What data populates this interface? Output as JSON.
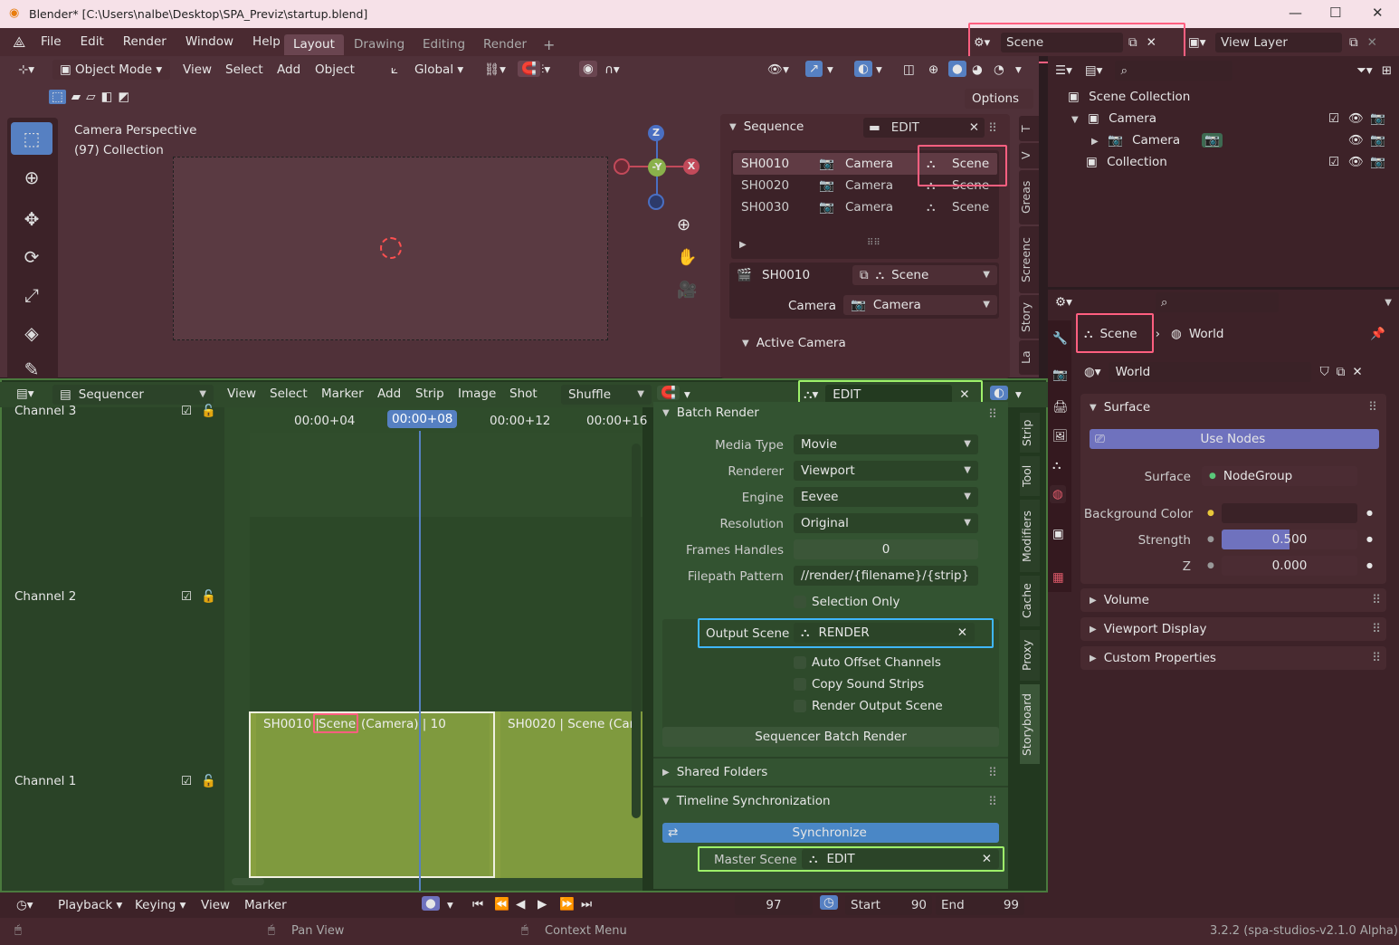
{
  "window": {
    "title": "Blender* [C:\\Users\\nalbe\\Desktop\\SPA_Previz\\startup.blend]"
  },
  "menu": {
    "items": [
      "File",
      "Edit",
      "Render",
      "Window",
      "Help"
    ]
  },
  "workspaces": [
    "Layout",
    "Drawing",
    "Editing",
    "Render"
  ],
  "scene_selector": {
    "value": "Scene"
  },
  "view_layer": {
    "value": "View Layer"
  },
  "viewport": {
    "mode": "Object Mode",
    "menus": [
      "View",
      "Select",
      "Add",
      "Object"
    ],
    "orientation": "Global",
    "options": "Options",
    "overlay_title": "Camera Perspective",
    "overlay_sub": "(97) Collection",
    "gizmo": {
      "z": "Z",
      "y": "-Y",
      "x": "X"
    }
  },
  "sequence_panel": {
    "title": "Sequence",
    "scene": "EDIT",
    "shots": [
      {
        "name": "SH0010",
        "camera": "Camera",
        "scene": "Scene"
      },
      {
        "name": "SH0020",
        "camera": "Camera",
        "scene": "Scene"
      },
      {
        "name": "SH0030",
        "camera": "Camera",
        "scene": "Scene"
      }
    ],
    "active_shot": "SH0010",
    "active_scene": "Scene",
    "camera_label": "Camera",
    "camera_value": "Camera",
    "active_camera": "Active Camera",
    "tabs": [
      "T",
      "V",
      "Greas",
      "Screenc",
      "Story",
      "La"
    ]
  },
  "sequencer": {
    "editor": "Sequencer",
    "menus": [
      "View",
      "Select",
      "Marker",
      "Add",
      "Strip",
      "Image",
      "Shot"
    ],
    "mode": "Shuffle",
    "scene": "EDIT",
    "channels": [
      "Channel 3",
      "Channel 2",
      "Channel 1"
    ],
    "ticks": [
      "00:00+04",
      "00:00+08",
      "00:00+12",
      "00:00+16"
    ],
    "current_tick": "00:00+08",
    "strip1": {
      "shot": "SH0010 |",
      "scene": "Scene",
      "rest": "(Camera) | 10"
    },
    "strip2": "SH0020 | Scene (Cam",
    "tabs": [
      "Strip",
      "Tool",
      "Modifiers",
      "Cache",
      "Proxy",
      "Storyboard"
    ]
  },
  "batch_render": {
    "title": "Batch Render",
    "media_type_label": "Media Type",
    "media_type": "Movie",
    "renderer_label": "Renderer",
    "renderer": "Viewport",
    "engine_label": "Engine",
    "engine": "Eevee",
    "resolution_label": "Resolution",
    "resolution": "Original",
    "frames_handles_label": "Frames Handles",
    "frames_handles": "0",
    "filepath_label": "Filepath Pattern",
    "filepath": "//render/{filename}/{strip}",
    "selection_only": "Selection Only",
    "output_scene_label": "Output Scene",
    "output_scene": "RENDER",
    "auto_offset": "Auto Offset Channels",
    "copy_sound": "Copy Sound Strips",
    "render_output": "Render Output Scene",
    "button": "Sequencer Batch Render"
  },
  "shared_folders": "Shared Folders",
  "timeline_sync": {
    "title": "Timeline Synchronization",
    "button": "Synchronize",
    "master_label": "Master Scene",
    "master_value": "EDIT"
  },
  "outliner": {
    "items": [
      {
        "label": "Scene Collection"
      },
      {
        "label": "Camera"
      },
      {
        "label": "Camera"
      },
      {
        "label": "Collection"
      }
    ]
  },
  "properties": {
    "breadcrumb_scene": "Scene",
    "breadcrumb_world": "World",
    "world_name": "World",
    "surface_title": "Surface",
    "use_nodes": "Use Nodes",
    "surface_label": "Surface",
    "surface_value": "NodeGroup",
    "bg_label": "Background Color",
    "strength_label": "Strength",
    "strength": "0.500",
    "z_label": "Z",
    "z": "0.000",
    "sections": [
      "Volume",
      "Viewport Display",
      "Custom Properties"
    ]
  },
  "timeline": {
    "menus": [
      "Playback",
      "Keying",
      "View",
      "Marker"
    ],
    "frame": "97",
    "start_label": "Start",
    "start": "90",
    "end_label": "End",
    "end": "99"
  },
  "status": {
    "pan": "Pan View",
    "context": "Context Menu",
    "version": "3.2.2 (spa-studios-v2.1.0 Alpha)"
  }
}
